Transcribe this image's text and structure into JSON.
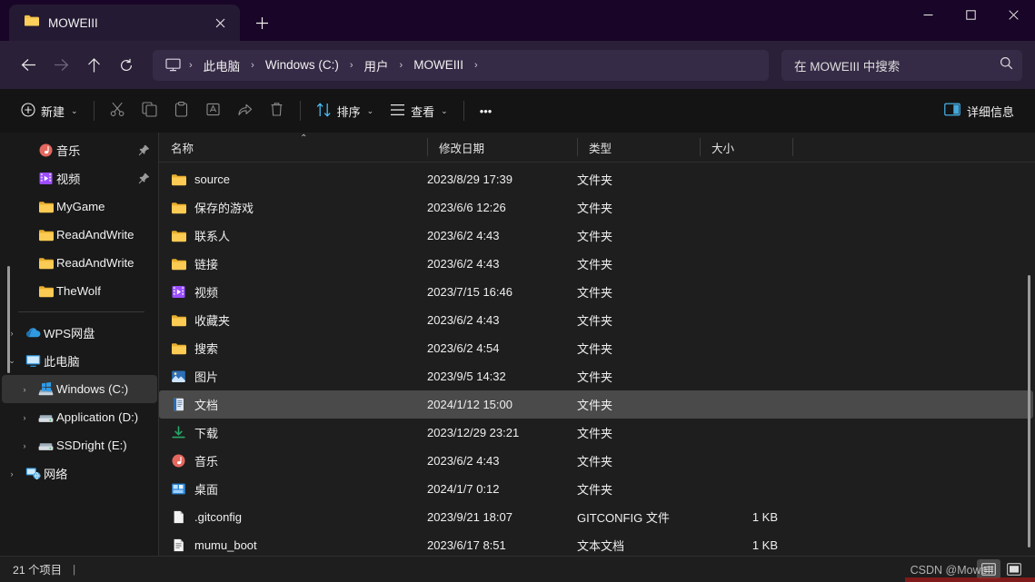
{
  "window": {
    "tab_title": "MOWEIII",
    "tab_close_icon": "close-icon",
    "new_tab_icon": "plus-icon",
    "minimize_label": "—",
    "maximize_label": "□",
    "close_label": "✕"
  },
  "nav": {
    "back_icon": "arrow-left-icon",
    "forward_icon": "arrow-right-icon",
    "up_icon": "arrow-up-icon",
    "refresh_icon": "refresh-icon",
    "breadcrumb": [
      {
        "label": "此电脑"
      },
      {
        "label": "Windows (C:)"
      },
      {
        "label": "用户"
      },
      {
        "label": "MOWEIII"
      }
    ],
    "separator": "›"
  },
  "search": {
    "value": "在 MOWEIII 中搜索",
    "icon": "search-icon"
  },
  "toolbar": {
    "new_label": "新建",
    "new_icon": "plus-circle-icon",
    "cut_icon": "scissors-icon",
    "copy_icon": "copy-icon",
    "paste_icon": "clipboard-icon",
    "rename_icon": "rename-icon",
    "share_icon": "share-icon",
    "delete_icon": "trash-icon",
    "sort_label": "排序",
    "sort_icon": "sort-icon",
    "view_label": "查看",
    "view_icon": "list-icon",
    "more_label": "•••",
    "details_label": "详细信息",
    "details_icon": "details-pane-icon",
    "caret": "⌄"
  },
  "sidebar": {
    "items": [
      {
        "label": "音乐",
        "icon": "music-icon",
        "chevron": "",
        "pinned": true,
        "selected": false,
        "indent": 1
      },
      {
        "label": "视频",
        "icon": "video-icon",
        "chevron": "",
        "pinned": true,
        "selected": false,
        "indent": 1
      },
      {
        "label": "MyGame",
        "icon": "folder-icon",
        "chevron": "",
        "pinned": false,
        "selected": false,
        "indent": 1
      },
      {
        "label": "ReadAndWrite",
        "icon": "folder-icon",
        "chevron": "",
        "pinned": false,
        "selected": false,
        "indent": 1
      },
      {
        "label": "ReadAndWrite",
        "icon": "folder-icon",
        "chevron": "",
        "pinned": false,
        "selected": false,
        "indent": 1
      },
      {
        "label": "TheWolf",
        "icon": "folder-icon",
        "chevron": "",
        "pinned": false,
        "selected": false,
        "indent": 1
      }
    ],
    "items2": [
      {
        "label": "WPS网盘",
        "icon": "cloud-icon",
        "chevron": "›",
        "selected": false,
        "indent": 0
      },
      {
        "label": "此电脑",
        "icon": "pc-icon",
        "chevron": "⌄",
        "selected": false,
        "indent": 0
      },
      {
        "label": "Windows (C:)",
        "icon": "windows-drive-icon",
        "chevron": "›",
        "selected": true,
        "indent": 1
      },
      {
        "label": "Application (D:)",
        "icon": "drive-icon",
        "chevron": "›",
        "selected": false,
        "indent": 1
      },
      {
        "label": "SSDright (E:)",
        "icon": "drive-icon",
        "chevron": "›",
        "selected": false,
        "indent": 1
      },
      {
        "label": "网络",
        "icon": "network-icon",
        "chevron": "›",
        "selected": false,
        "indent": 0
      }
    ]
  },
  "columns": {
    "name": "名称",
    "date": "修改日期",
    "type": "类型",
    "size": "大小",
    "sort_caret": "⌃"
  },
  "files": [
    {
      "name": "source",
      "date": "2023/8/29 17:39",
      "type": "文件夹",
      "size": "",
      "icon": "folder-icon",
      "selected": false
    },
    {
      "name": "保存的游戏",
      "date": "2023/6/6 12:26",
      "type": "文件夹",
      "size": "",
      "icon": "folder-icon",
      "selected": false
    },
    {
      "name": "联系人",
      "date": "2023/6/2 4:43",
      "type": "文件夹",
      "size": "",
      "icon": "folder-icon",
      "selected": false
    },
    {
      "name": "链接",
      "date": "2023/6/2 4:43",
      "type": "文件夹",
      "size": "",
      "icon": "folder-icon",
      "selected": false
    },
    {
      "name": "视频",
      "date": "2023/7/15 16:46",
      "type": "文件夹",
      "size": "",
      "icon": "video-icon",
      "selected": false
    },
    {
      "name": "收藏夹",
      "date": "2023/6/2 4:43",
      "type": "文件夹",
      "size": "",
      "icon": "folder-icon",
      "selected": false
    },
    {
      "name": "搜索",
      "date": "2023/6/2 4:54",
      "type": "文件夹",
      "size": "",
      "icon": "folder-icon",
      "selected": false
    },
    {
      "name": "图片",
      "date": "2023/9/5 14:32",
      "type": "文件夹",
      "size": "",
      "icon": "pictures-icon",
      "selected": false
    },
    {
      "name": "文档",
      "date": "2024/1/12 15:00",
      "type": "文件夹",
      "size": "",
      "icon": "documents-icon",
      "selected": true
    },
    {
      "name": "下载",
      "date": "2023/12/29 23:21",
      "type": "文件夹",
      "size": "",
      "icon": "download-icon",
      "selected": false
    },
    {
      "name": "音乐",
      "date": "2023/6/2 4:43",
      "type": "文件夹",
      "size": "",
      "icon": "music-icon",
      "selected": false
    },
    {
      "name": "桌面",
      "date": "2024/1/7 0:12",
      "type": "文件夹",
      "size": "",
      "icon": "desktop-icon",
      "selected": false
    },
    {
      "name": ".gitconfig",
      "date": "2023/9/21 18:07",
      "type": "GITCONFIG 文件",
      "size": "1 KB",
      "icon": "file-icon",
      "selected": false
    },
    {
      "name": "mumu_boot",
      "date": "2023/6/17 8:51",
      "type": "文本文档",
      "size": "1 KB",
      "icon": "text-file-icon",
      "selected": false
    }
  ],
  "status": {
    "item_count": "21 个项目",
    "separator": "|",
    "view_details_icon": "details-view-icon",
    "view_thumbnail_icon": "thumbnail-view-icon"
  },
  "watermark": {
    "text": "CSDN @MoweIII"
  },
  "colors": {
    "titlebar": "#190527",
    "navbar": "#2a2038",
    "toolbar": "#141414",
    "content": "#1e1e1e",
    "sidebar": "#191919",
    "selection": "#4a4a4a",
    "accent": "#4cc2ff",
    "folder": "#eab430"
  }
}
